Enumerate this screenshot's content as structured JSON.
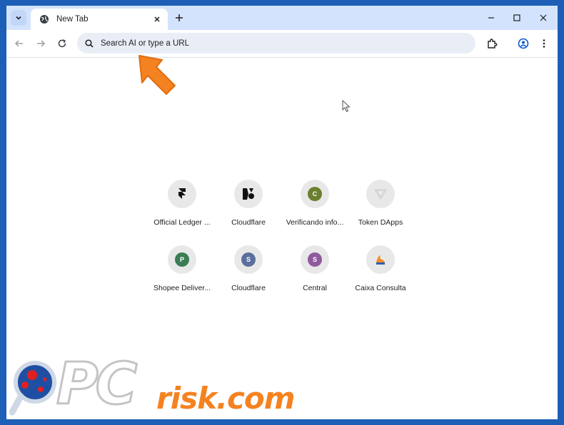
{
  "tab": {
    "title": "New Tab",
    "favicon": "globe-icon"
  },
  "omnibox": {
    "placeholder": "Search AI or type a URL"
  },
  "shortcuts": [
    {
      "label": "Official Ledger ...",
      "icon": "framer-icon"
    },
    {
      "label": "Cloudflare",
      "icon": "cloudflare-icon"
    },
    {
      "label": "Verificando info...",
      "icon": "letter-c-icon",
      "letter": "C",
      "color": "#6b7f2e"
    },
    {
      "label": "Token DApps",
      "icon": "chevron-shield-icon"
    },
    {
      "label": "Shopee Deliver...",
      "icon": "letter-p-icon",
      "letter": "P",
      "color": "#3a7d55"
    },
    {
      "label": "Cloudflare",
      "icon": "letter-s-icon",
      "letter": "S",
      "color": "#5a6f9c"
    },
    {
      "label": "Central",
      "icon": "letter-s-icon",
      "letter": "S",
      "color": "#8f5a9e"
    },
    {
      "label": "Caixa Consulta",
      "icon": "caixa-icon"
    }
  ],
  "watermark": {
    "pc": "PC",
    "risk": "risk.com"
  },
  "colors": {
    "accent_arrow": "#f58220",
    "tabstrip": "#d3e3fd",
    "frame": "#1d5fb6"
  }
}
